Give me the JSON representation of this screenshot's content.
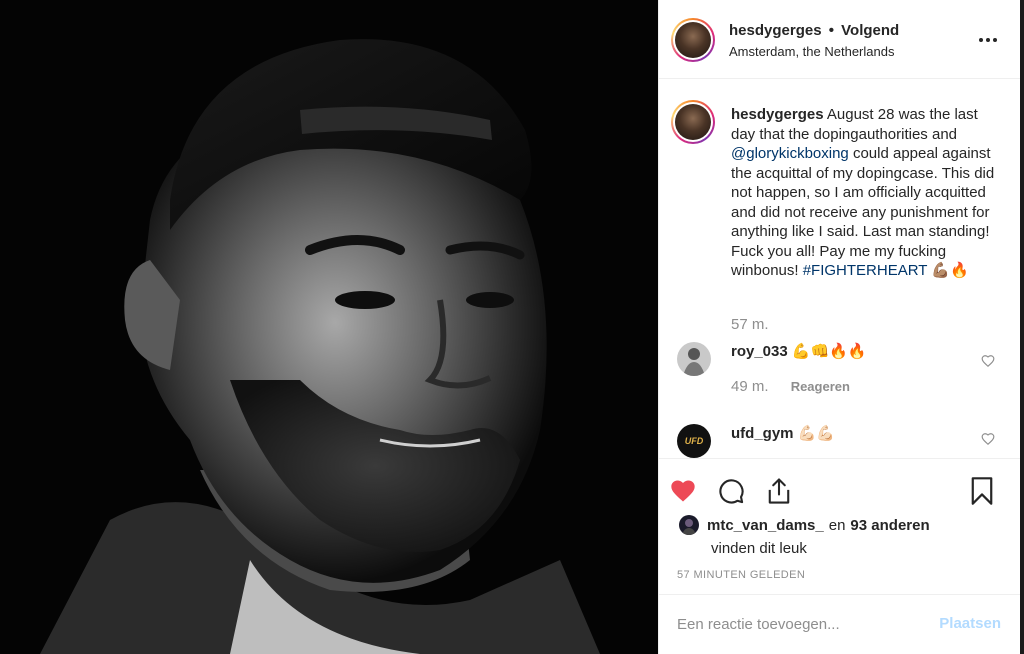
{
  "post": {
    "author": "hesdygerges",
    "separator": "•",
    "follow_status": "Volgend",
    "location": "Amsterdam, the Netherlands"
  },
  "caption": {
    "username": "hesdygerges",
    "text_1": " August 28 was the last day that the dopingauthorities and ",
    "mention": "@glorykickboxing",
    "text_2": " could appeal against the acquittal of my dopingcase. This did not happen, so I am officially acquitted and did not receive any punishment for anything like I said. Last man standing! Fuck you all! Pay me my fucking winbonus! ",
    "hashtag": "#FIGHTERHEART",
    "emoji": " 💪🏽🔥",
    "time": "57 m."
  },
  "comments": [
    {
      "username": "roy_033",
      "text": "💪👊🔥🔥",
      "time": "49 m.",
      "reply_label": "Reageren"
    },
    {
      "username": "ufd_gym",
      "text": "💪🏻💪🏻",
      "avatar_text": "UFD"
    }
  ],
  "likes": {
    "first_user": "mtc_van_dams_",
    "conjunction": "en",
    "others": "93 anderen",
    "suffix": "vinden dit leuk"
  },
  "timestamp": "57 minuten geleden",
  "add_comment": {
    "placeholder": "Een reactie toevoegen...",
    "post_label": "Plaatsen"
  },
  "colors": {
    "like_red": "#ed4956",
    "link_blue": "#003569",
    "post_disabled": "#b3dbff",
    "muted": "#8e8e8e"
  },
  "icons": [
    "more-icon",
    "heart-icon",
    "comment-icon",
    "share-icon",
    "bookmark-icon",
    "heart-outline-icon"
  ]
}
